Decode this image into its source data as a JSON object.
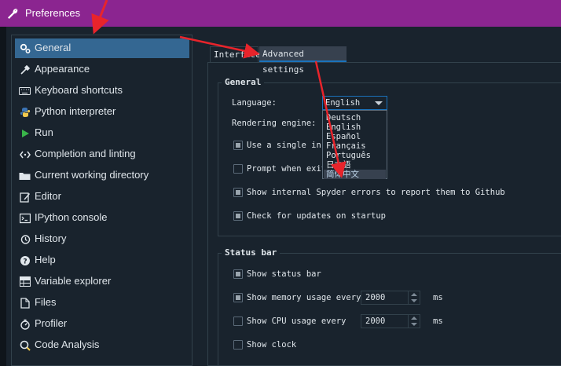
{
  "window": {
    "title": "Preferences",
    "titlebar_color": "#8b2590"
  },
  "sidebar": {
    "items": [
      {
        "label": "General",
        "icon": "gears-icon",
        "selected": true
      },
      {
        "label": "Appearance",
        "icon": "eyedropper-icon"
      },
      {
        "label": "Keyboard shortcuts",
        "icon": "keyboard-icon"
      },
      {
        "label": "Python interpreter",
        "icon": "python-icon"
      },
      {
        "label": "Run",
        "icon": "play-icon"
      },
      {
        "label": "Completion and linting",
        "icon": "completion-icon"
      },
      {
        "label": "Current working directory",
        "icon": "folder-icon"
      },
      {
        "label": "Editor",
        "icon": "edit-icon"
      },
      {
        "label": "IPython console",
        "icon": "ipython-icon"
      },
      {
        "label": "History",
        "icon": "history-icon"
      },
      {
        "label": "Help",
        "icon": "help-icon"
      },
      {
        "label": "Variable explorer",
        "icon": "table-icon"
      },
      {
        "label": "Files",
        "icon": "files-icon"
      },
      {
        "label": "Profiler",
        "icon": "profiler-icon"
      },
      {
        "label": "Code Analysis",
        "icon": "code-analysis-icon"
      }
    ]
  },
  "tabs": [
    {
      "label": "Interface"
    },
    {
      "label": "Advanced settings",
      "active": true
    }
  ],
  "general": {
    "title": "General",
    "language_label": "Language:",
    "language_value": "English",
    "rendering_label": "Rendering engine:",
    "options": [
      {
        "label": "Use a single ins",
        "checked": true
      },
      {
        "label": "Prompt when exit",
        "checked": false
      },
      {
        "label": "Show internal Spyder errors to report them to Github",
        "checked": true
      },
      {
        "label": "Check for updates on startup",
        "checked": true
      }
    ]
  },
  "language_dropdown": {
    "options": [
      "Deutsch",
      "English",
      "Español",
      "Français",
      "Português",
      "日本語",
      "简体中文"
    ],
    "highlighted": "简体中文"
  },
  "status_bar": {
    "title": "Status bar",
    "show_status_bar": {
      "label": "Show status bar",
      "checked": true
    },
    "memory": {
      "label": "Show memory usage every",
      "checked": true,
      "value": "2000",
      "unit": "ms"
    },
    "cpu": {
      "label": "Show CPU usage every",
      "checked": false,
      "value": "2000",
      "unit": "ms"
    },
    "clock": {
      "label": "Show clock",
      "checked": false
    }
  },
  "colors": {
    "selection": "#346792",
    "annotation_arrow": "#e8242b",
    "background": "#19232d"
  }
}
